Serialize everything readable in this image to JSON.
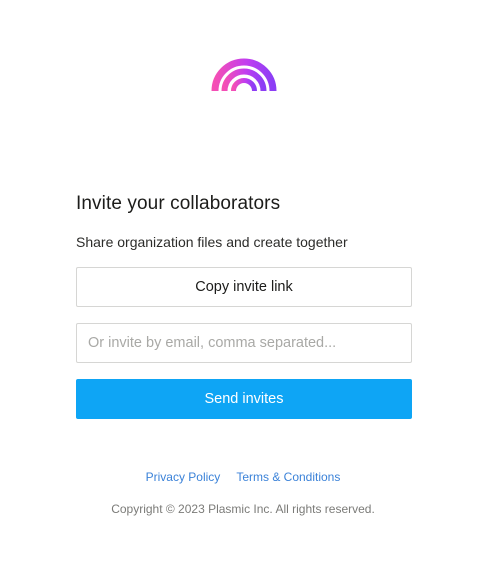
{
  "brand": {
    "logo_icon": "plasmic-rainbow-logo-icon",
    "gradient_colors": [
      "#f54fb4",
      "#c13df0",
      "#8b3ef5"
    ]
  },
  "invite": {
    "title": "Invite your collaborators",
    "subtitle": "Share organization files and create together",
    "copy_link_label": "Copy invite link",
    "email_value": "",
    "email_placeholder": "Or invite by email, comma separated...",
    "send_label": "Send invites",
    "send_color": "#0ea5f5"
  },
  "footer": {
    "privacy_label": "Privacy Policy",
    "terms_label": "Terms & Conditions",
    "copyright": "Copyright © 2023 Plasmic Inc. All rights reserved.",
    "link_color": "#3b82d8"
  }
}
